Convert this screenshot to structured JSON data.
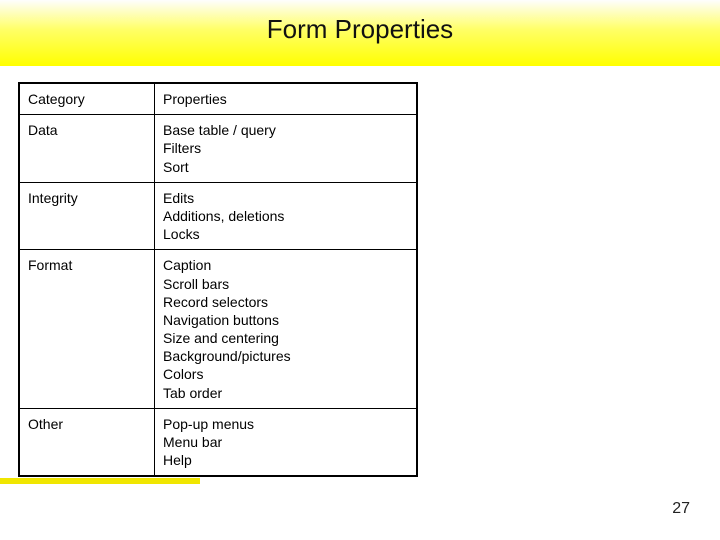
{
  "title": "Form Properties",
  "page_number": "27",
  "table": {
    "headers": [
      "Category",
      "Properties"
    ],
    "rows": [
      {
        "category": "Data",
        "properties": "Base table / query\nFilters\nSort"
      },
      {
        "category": "Integrity",
        "properties": "Edits\nAdditions, deletions\nLocks"
      },
      {
        "category": "Format",
        "properties": "Caption\nScroll bars\nRecord selectors\nNavigation buttons\nSize and centering\nBackground/pictures\nColors\nTab order"
      },
      {
        "category": "Other",
        "properties": "Pop-up menus\nMenu bar\nHelp"
      }
    ]
  }
}
